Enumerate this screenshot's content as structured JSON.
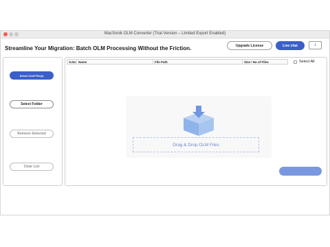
{
  "window": {
    "title": "MacSonik OLM Converter (Trial Version – Limited Export Enabled)"
  },
  "header": {
    "headline": "Streamline Your Migration: Batch OLM Processing Without the Friction.",
    "upgrade_label": "Upgrade License",
    "livechat_label": "Live chat",
    "info_label": "i"
  },
  "sidebar": {
    "select_olm_label": "Select OLM File(s)",
    "select_folder_label": "Select Folder",
    "remove_selected_label": "Remove Selected",
    "clear_list_label": "Clear List"
  },
  "table": {
    "columns": [
      "S.No",
      "Name",
      "File Path",
      "Size / No of Files"
    ],
    "select_all_label": "Select All"
  },
  "dropzone": {
    "label": "Drag & Drop OLM Files",
    "icon": "box-download-icon"
  },
  "footer": {
    "next_label": ""
  },
  "colors": {
    "accent": "#3a5fc8",
    "accent_light": "#7a98e0",
    "icon_blue": "#8fb4ea"
  }
}
